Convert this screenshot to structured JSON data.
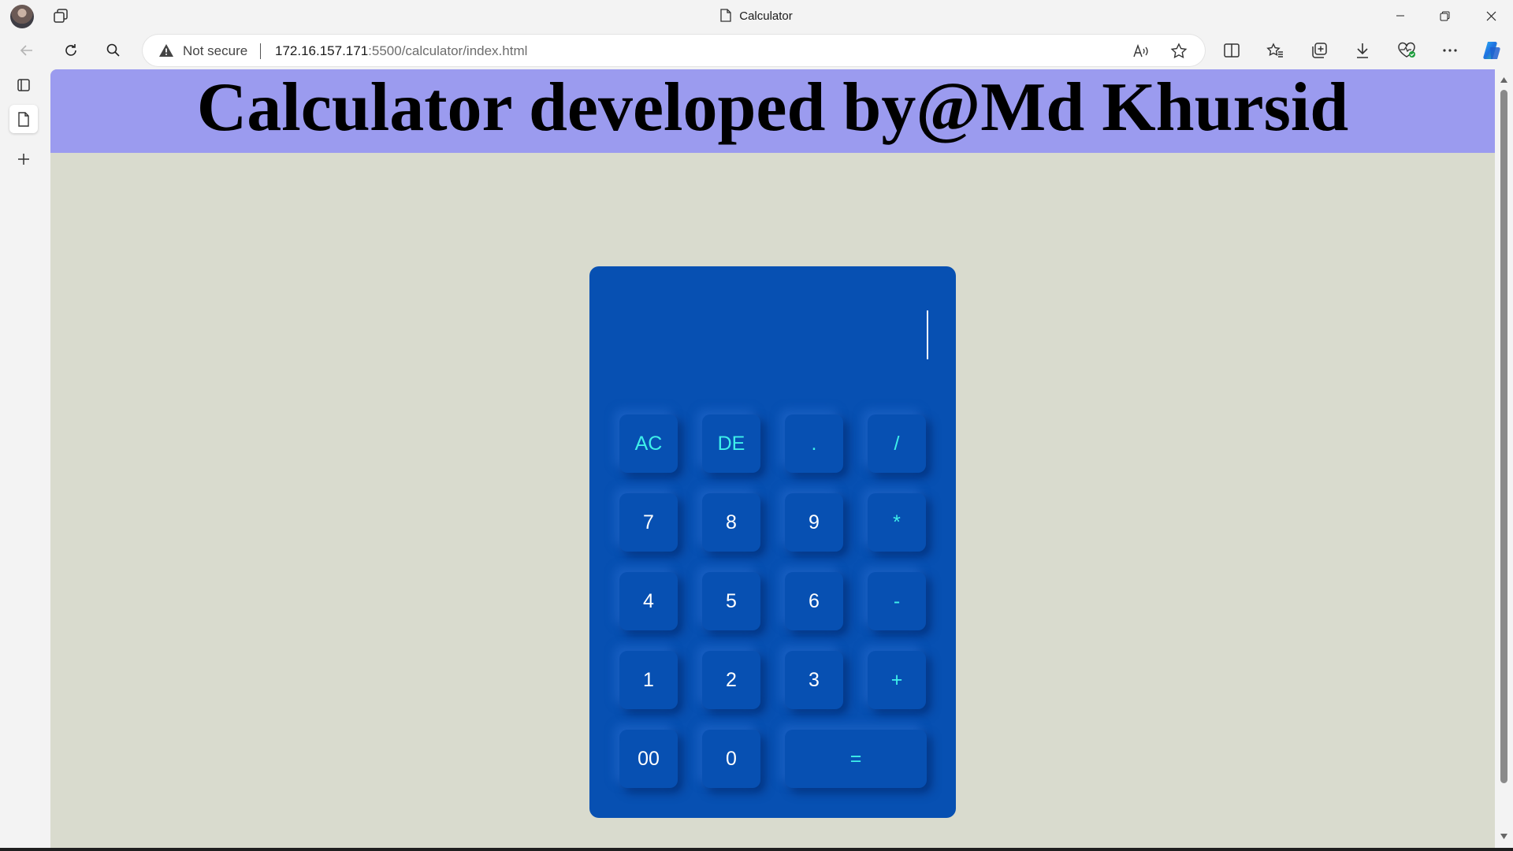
{
  "window": {
    "title": "Calculator",
    "icons": [
      "profile-avatar",
      "workspaces-icon",
      "document-icon",
      "minimize-icon",
      "restore-icon",
      "close-icon"
    ]
  },
  "address_bar": {
    "security_label": "Not secure",
    "url_host": "172.16.157.171",
    "url_rest": ":5500/calculator/index.html"
  },
  "toolbar": {
    "icons": [
      "back-icon",
      "refresh-icon",
      "search-icon",
      "read-aloud-icon",
      "favorite-star-icon",
      "split-screen-icon",
      "favorites-icon",
      "collections-icon",
      "downloads-icon",
      "browser-essentials-icon",
      "more-icon",
      "copilot-icon"
    ]
  },
  "sidebar": {
    "icons": [
      "tab-actions-icon",
      "page-tab-icon",
      "new-tab-icon"
    ]
  },
  "page": {
    "heading": "Calculator developed by@Md Khursid",
    "display_value": "",
    "keys": {
      "ac": "AC",
      "de": "DE",
      "dot": ".",
      "divide": "/",
      "seven": "7",
      "eight": "8",
      "nine": "9",
      "multiply": "*",
      "four": "4",
      "five": "5",
      "six": "6",
      "minus": "-",
      "one": "1",
      "two": "2",
      "three": "3",
      "plus": "+",
      "double_zero": "00",
      "zero": "0",
      "equals": "="
    }
  },
  "colors": {
    "banner": "#9b9bef",
    "page_background": "#d9dbce",
    "calculator_body": "#0750b2",
    "operator_text": "#3ef0ea",
    "digit_text": "#ffffff"
  }
}
